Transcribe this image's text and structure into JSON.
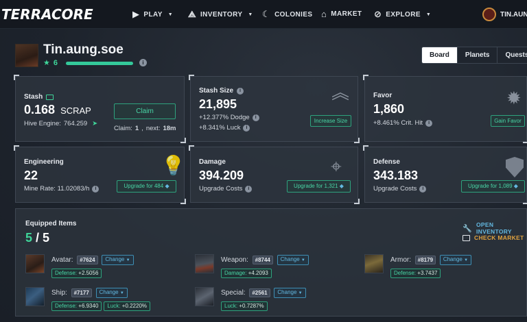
{
  "nav": {
    "logo": "TERRACORE",
    "play": "PLAY",
    "inventory": "INVENTORY",
    "colonies": "COLONIES",
    "market": "MARKET",
    "explore": "EXPLORE",
    "user": "TIN.AUNG"
  },
  "profile": {
    "name": "Tin.aung.soe",
    "level": "6",
    "xp_progress_percent": 100
  },
  "tabs": [
    "Board",
    "Planets",
    "Quests"
  ],
  "stash": {
    "title": "Stash",
    "value": "0.168",
    "unit": "SCRAP",
    "hive_label": "Hive Engine:",
    "hive_value": "764.259",
    "claim_button": "Claim",
    "claim_label": "Claim:",
    "claim_count": "1",
    "claim_next_label": "next:",
    "claim_next": "18m"
  },
  "stash_size": {
    "title": "Stash Size",
    "value": "21,895",
    "dodge": "+12.377% Dodge",
    "luck": "+8.341% Luck",
    "button": "Increase Size"
  },
  "favor": {
    "title": "Favor",
    "value": "1,860",
    "crit": "+8.461% Crit. Hit",
    "button": "Gain Favor"
  },
  "engineering": {
    "title": "Engineering",
    "value": "22",
    "rate": "Mine Rate: 11.02083/h",
    "button": "Upgrade for 484"
  },
  "damage": {
    "title": "Damage",
    "value": "394.209",
    "sub": "Upgrade Costs",
    "button": "Upgrade for 1,321"
  },
  "defense": {
    "title": "Defense",
    "value": "343.183",
    "sub": "Upgrade Costs",
    "button": "Upgrade for 1,089"
  },
  "equipped": {
    "title": "Equipped Items",
    "count_current": "5",
    "count_sep": " / ",
    "count_total": "5",
    "open_inventory": "OPEN INVENTORY",
    "check_market": "CHECK MARKET",
    "change_label": "Change",
    "items": [
      {
        "name": "Avatar:",
        "id": "#7624",
        "stats": [
          {
            "k": "Defense:",
            "v": "+2.5056"
          }
        ]
      },
      {
        "name": "Weapon:",
        "id": "#8744",
        "stats": [
          {
            "k": "Damage:",
            "v": "+4.2093"
          }
        ]
      },
      {
        "name": "Armor:",
        "id": "#8179",
        "stats": [
          {
            "k": "Defense:",
            "v": "+3.7437"
          }
        ]
      },
      {
        "name": "Ship:",
        "id": "#7177",
        "stats": [
          {
            "k": "Defense:",
            "v": "+6.9340"
          },
          {
            "k": "Luck:",
            "v": "+0.2220%"
          }
        ]
      },
      {
        "name": "Special:",
        "id": "#2561",
        "stats": [
          {
            "k": "Luck:",
            "v": "+0.7287%"
          }
        ]
      }
    ]
  },
  "colors": {
    "accent_green": "#3fd69a",
    "accent_blue": "#63b8e0",
    "accent_orange": "#e0a23f"
  }
}
